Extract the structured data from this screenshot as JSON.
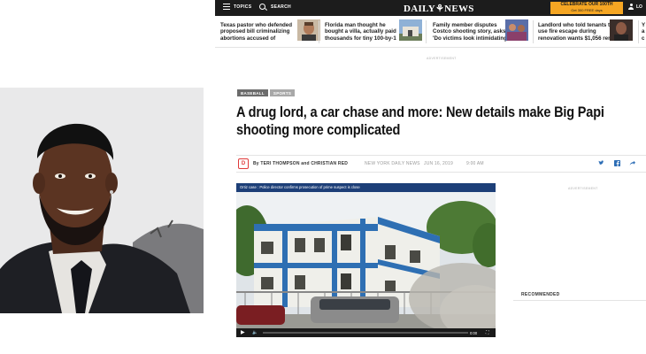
{
  "nav": {
    "topics_label": "TOPICS",
    "search_label": "SEARCH",
    "logo_text": "DAILY⚘NEWS",
    "promo_line1": "CELEBRATE OUR 100TH",
    "promo_line2": "Get 300 FREE days",
    "login_label": "LO"
  },
  "trending": [
    {
      "text": "Texas pastor who defended proposed bill criminalizing abortions accused of",
      "thumb": "man-portrait"
    },
    {
      "text": "Florida man thought he bought a villa, actually paid thousands for tiny 100-by-1",
      "thumb": "shed"
    },
    {
      "text": "Family member disputes Costco shooting story, asks: 'Do victims look intimidating",
      "thumb": "family"
    },
    {
      "text": "Landlord who told tenants to use fire escape during renovation wants $1,056 rent",
      "thumb": "landlord"
    }
  ],
  "ad_label": "ADVERTISEMENT",
  "article": {
    "tags": [
      "BASEBALL",
      "SPORTS"
    ],
    "headline_line1": "A drug lord, a car chase and more: New details make Big Papi",
    "headline_line2": "shooting more complicated",
    "badge": "D",
    "byline": "By TERI THOMPSON  and CHRISTIAN RED",
    "source": "NEW YORK DAILY NEWS",
    "date": "JUN 16, 2019",
    "time": "9:00 AM"
  },
  "video": {
    "caption": "Ortiz case : Police director confirms prosecution of prime suspect is close",
    "time": "0:00",
    "progress": 0
  },
  "rail": {
    "ad_label": "ADVERTISEMENT",
    "recommended": "RECOMMENDED"
  },
  "colors": {
    "topbar": "#1c1c1c",
    "promo": "#f5a623",
    "video_caption": "#1d3f78",
    "social": "#2c6db5",
    "badge": "#e03b3b"
  }
}
